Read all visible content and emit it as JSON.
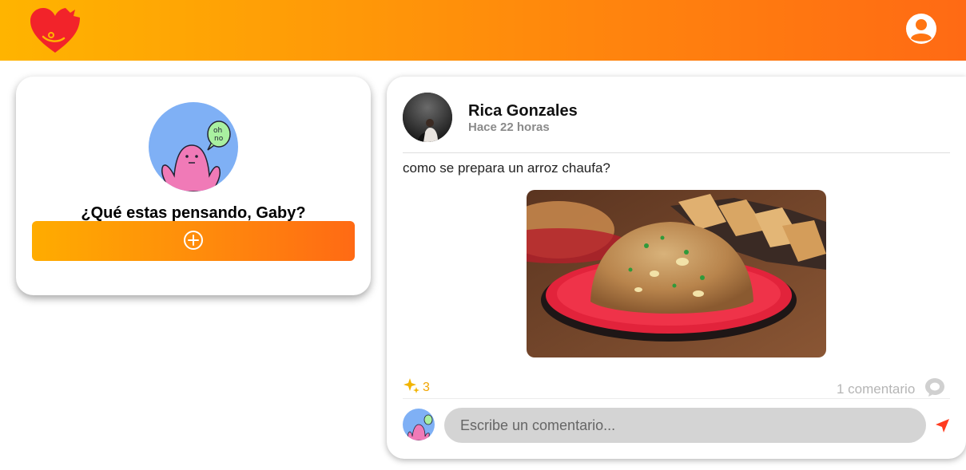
{
  "header": {
    "logo_icon": "heart-logo-icon",
    "profile_icon": "user-profile-icon",
    "gradient": [
      "#ffb400",
      "#ff6a14"
    ]
  },
  "create_post": {
    "prompt": "¿Qué estas pensando, Gaby?",
    "button_icon": "plus-circle-icon"
  },
  "post": {
    "author": "Rica Gonzales",
    "time": "Hace 22 horas",
    "text": "como se prepara un arroz chaufa?",
    "image": "fried-rice-photo",
    "reactions": {
      "icon": "sparkles-icon",
      "count": "3"
    },
    "comments": {
      "label": "1 comentario",
      "icon": "comment-bubble-icon"
    },
    "comment_box": {
      "placeholder": "Escribe un comentario...",
      "send_icon": "send-icon"
    }
  },
  "colors": {
    "accent": "#ff8a0c",
    "reaction": "#f2a500",
    "send": "#ff3b1f"
  }
}
